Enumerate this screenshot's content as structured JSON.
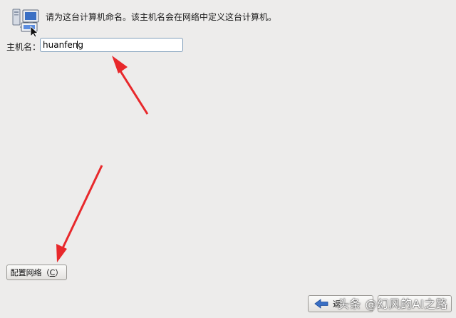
{
  "header": {
    "icon": "network-computers-icon",
    "text": "请为这台计算机命名。该主机名会在网络中定义这台计算机。"
  },
  "hostname": {
    "label": "主机名：",
    "value": "huanfeng"
  },
  "config_button": {
    "label_prefix": "配置网络（",
    "mnemonic": "C",
    "label_suffix": "）"
  },
  "footer": {
    "back_label": "返",
    "back_icon": "arrow-left-icon"
  },
  "watermark": "头条 @幻风的AI之路",
  "colors": {
    "background": "#edeceb",
    "annotation_arrow": "#e8282b",
    "input_border": "#7f9db9"
  }
}
